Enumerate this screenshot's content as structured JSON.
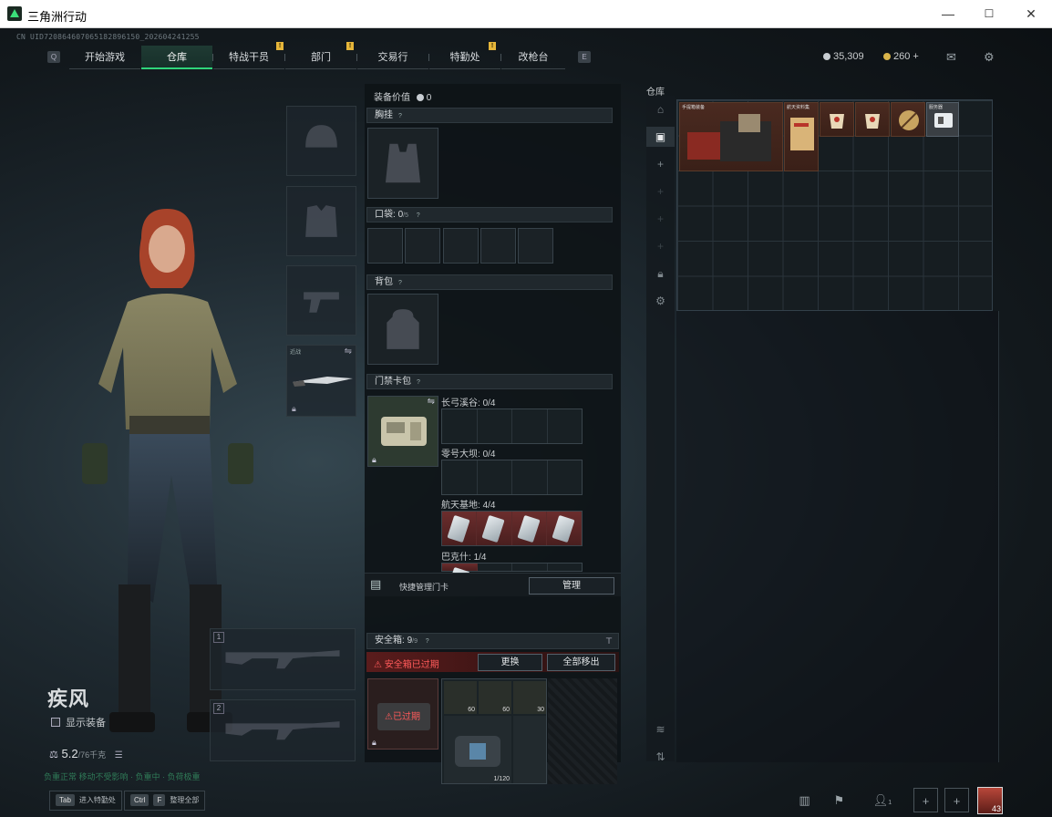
{
  "window": {
    "title": "三角洲行动",
    "minimize": "—",
    "maximize": "☐",
    "close": "✕"
  },
  "uid": "CN UID720864607065182896150_202604241255",
  "nav": {
    "left_key": "Q",
    "right_key": "E",
    "tabs": [
      {
        "label": "开始游戏",
        "active": false,
        "badge": ""
      },
      {
        "label": "仓库",
        "active": true,
        "badge": ""
      },
      {
        "label": "特战干员",
        "active": false,
        "badge": "!"
      },
      {
        "label": "部门",
        "active": false,
        "badge": "!"
      },
      {
        "label": "交易行",
        "active": false,
        "badge": ""
      },
      {
        "label": "特勤处",
        "active": false,
        "badge": "!"
      },
      {
        "label": "改枪台",
        "active": false,
        "badge": ""
      }
    ]
  },
  "currency": {
    "silver": "35,309",
    "gold": "260",
    "plus": "+"
  },
  "operator": {
    "name": "疾风",
    "show_equipment": "显示装备",
    "weight": "5.2",
    "weight_max": "/76千克",
    "status_hint": "负重正常 移动不受影响 · 负重中 · 负荷极重",
    "weapon_slot_1": "1",
    "weapon_slot_2": "2",
    "melee_label": "近战"
  },
  "bottom_keys": [
    {
      "key": "Tab",
      "label": "进入特勤处"
    },
    {
      "key": "Ctrl",
      "key2": "F",
      "label": "整理全部"
    }
  ],
  "equipment": {
    "value_label": "装备价值",
    "value": "0",
    "chest_rig": "胸挂",
    "pockets_label": "口袋:",
    "pockets_value": "0",
    "pockets_max": "/5",
    "backpack": "背包",
    "keycard_case": "门禁卡包",
    "help": "?",
    "keycard_maps": [
      {
        "name": "长弓溪谷:",
        "count": "0/4"
      },
      {
        "name": "零号大坝:",
        "count": "0/4"
      },
      {
        "name": "航天基地:",
        "count": "4/4"
      },
      {
        "name": "巴克什:",
        "count": "1/4"
      }
    ],
    "quick_manage": "快捷管理门卡",
    "manage_button": "管理"
  },
  "safebox": {
    "label": "安全箱:",
    "value": "9",
    "max": "/9",
    "expired_warning": "安全箱已过期",
    "replace_button": "更换",
    "move_all_button": "全部移出",
    "expired_tag": "已过期",
    "item_counts": [
      "60",
      "60",
      "30"
    ],
    "bag_count": "1/120"
  },
  "warehouse": {
    "title": "仓库",
    "item_labels": [
      "手提箱装备",
      "航天资料集",
      "",
      "",
      "",
      "服务器"
    ]
  },
  "bottom_right": {
    "party_count": "1",
    "level": "43"
  },
  "colors": {
    "accent": "#2fd47a",
    "warning": "#ff5a5a",
    "badge": "#e6b63a"
  }
}
